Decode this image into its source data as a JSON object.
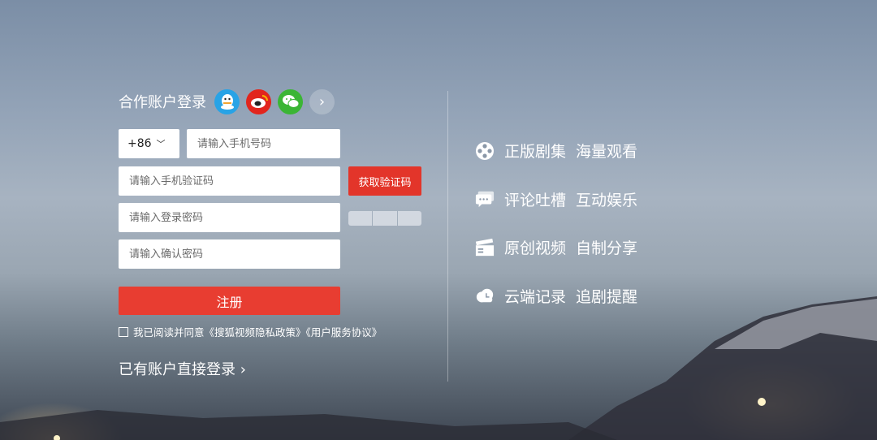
{
  "partner_login": {
    "title": "合作账户登录",
    "icons": [
      "qq-icon",
      "weibo-icon",
      "wechat-icon",
      "chevron-right-icon"
    ],
    "more_glyph": "›"
  },
  "form": {
    "country_code": "+86",
    "country_chevron": "﹀",
    "phone_placeholder": "请输入手机号码",
    "sms_placeholder": "请输入手机验证码",
    "get_code_label": "获取验证码",
    "password_placeholder": "请输入登录密码",
    "confirm_placeholder": "请输入确认密码",
    "register_label": "注册",
    "agree_text": "我已阅读并同意《搜狐视频隐私政策》《用户服务协议》",
    "login_link": "已有账户直接登录 ›"
  },
  "features": [
    {
      "a": "正版剧集",
      "b": "海量观看",
      "icon": "film-reel-icon"
    },
    {
      "a": "评论吐槽",
      "b": "互动娱乐",
      "icon": "comment-icon"
    },
    {
      "a": "原创视频",
      "b": "自制分享",
      "icon": "clapperboard-icon"
    },
    {
      "a": "云端记录",
      "b": "追剧提醒",
      "icon": "cloud-clock-icon"
    }
  ],
  "colors": {
    "accent": "#e83d31",
    "qq": "#28a3e6",
    "weibo": "#e2251d",
    "wechat": "#3bb535"
  }
}
